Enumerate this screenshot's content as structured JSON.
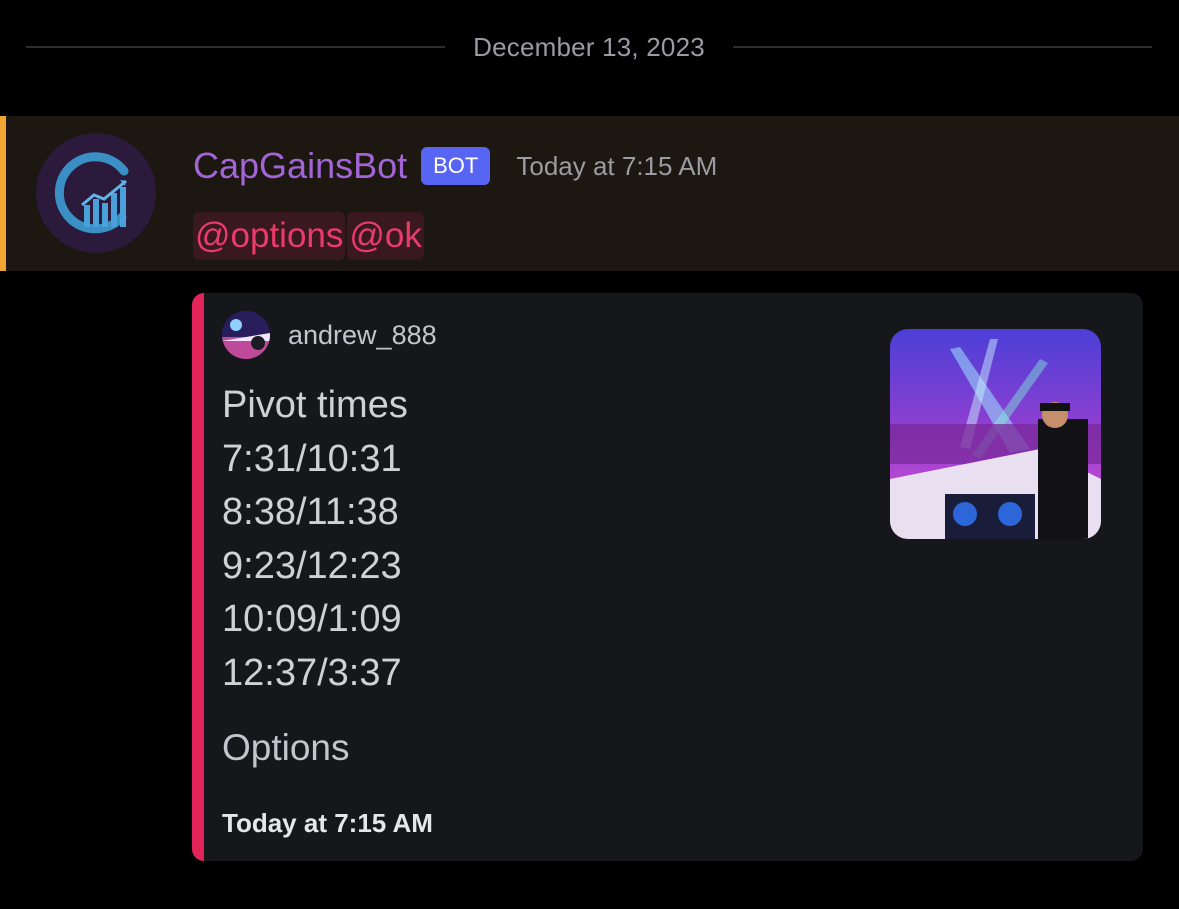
{
  "date_divider": "December 13, 2023",
  "message": {
    "username": "CapGainsBot",
    "bot_tag": "BOT",
    "timestamp": "Today at 7:15 AM",
    "mentions": [
      "@options",
      "@ok"
    ],
    "avatar_icon": "growth-chart-logo"
  },
  "embed": {
    "author_name": "andrew_888",
    "description_lines": [
      "Pivot times",
      "7:31/10:31",
      "8:38/11:38",
      "9:23/12:23",
      "10:09/1:09",
      "12:37/3:37"
    ],
    "field_name": "Options",
    "footer": "Today at 7:15 AM",
    "bar_color": "#e3245b"
  },
  "colors": {
    "username": "#a265d6",
    "bot_tag": "#5865f2",
    "mention": "#ea3b6b",
    "highlight_bar": "#f0a630"
  }
}
